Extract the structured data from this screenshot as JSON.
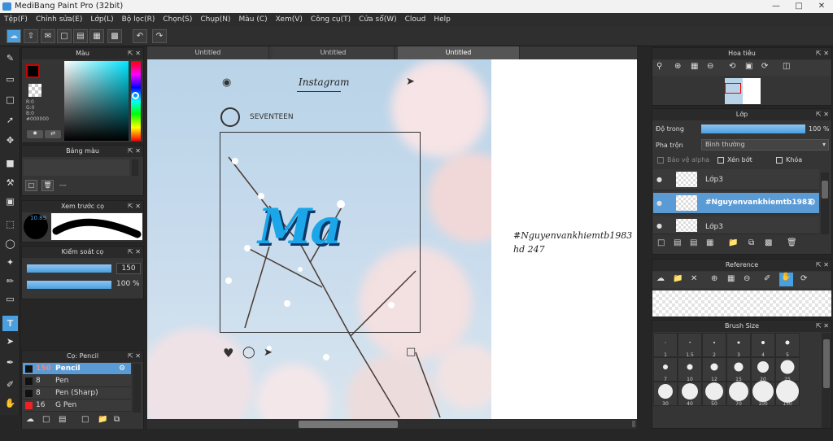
{
  "app": {
    "title": "MediBang Paint Pro (32bit)"
  },
  "menu": [
    "Tệp(F)",
    "Chỉnh sửa(E)",
    "Lớp(L)",
    "Bộ lọc(R)",
    "Chọn(S)",
    "Chụp(N)",
    "Màu (C)",
    "Xem(V)",
    "Công cụ(T)",
    "Cửa sổ(W)",
    "Cloud",
    "Help"
  ],
  "tabs": [
    "Untitled",
    "Untitled",
    "Untitled"
  ],
  "color_panel": {
    "title": "Màu",
    "r": "R:0",
    "g": "G:0",
    "b": "B:0",
    "hex": "#000000"
  },
  "palette_panel": {
    "title": "Bảng màu",
    "dashes": "---"
  },
  "preview_panel": {
    "title": "Xem trước cọ",
    "size": "10.89"
  },
  "control_panel": {
    "title": "Kiểm soát cọ",
    "size": "150",
    "opacity": "100 %"
  },
  "brush_panel": {
    "title": "Cọ: Pencil",
    "items": [
      {
        "size": "150",
        "name": "Pencil"
      },
      {
        "size": "8",
        "name": "Pen"
      },
      {
        "size": "8",
        "name": "Pen (Sharp)"
      },
      {
        "size": "16",
        "name": "G Pen"
      }
    ]
  },
  "canvas": {
    "ig_title": "Instagram",
    "account": "SEVENTEEN",
    "art_text": "Ma",
    "note_line1": "#Nguyenvankhiemtb1983",
    "note_line2": "hd 247"
  },
  "navigator": {
    "title": "Hoa tiêu"
  },
  "layer_panel": {
    "title": "Lớp",
    "opacity_label": "Độ trong",
    "opacity_value": "100 %",
    "blend_label": "Pha trộn",
    "blend_value": "Bình thường",
    "protect_alpha": "Bảo vệ alpha",
    "clip": "Xén bớt",
    "lock": "Khóa",
    "layers": [
      {
        "name": "Lớp3"
      },
      {
        "name": "#Nguyenvankhiemtb1983"
      },
      {
        "name": "Lớp3"
      }
    ]
  },
  "reference_panel": {
    "title": "Reference"
  },
  "brushsize_panel": {
    "title": "Brush Size",
    "sizes": [
      "1",
      "1.5",
      "2",
      "3",
      "4",
      "5",
      "7",
      "10",
      "12",
      "15",
      "20",
      "25",
      "30",
      "40",
      "50",
      "70",
      "100",
      "150"
    ]
  },
  "colors": {
    "accent": "#4a9fe0",
    "fg": "#000000",
    "selected": "#5b9bd5"
  }
}
